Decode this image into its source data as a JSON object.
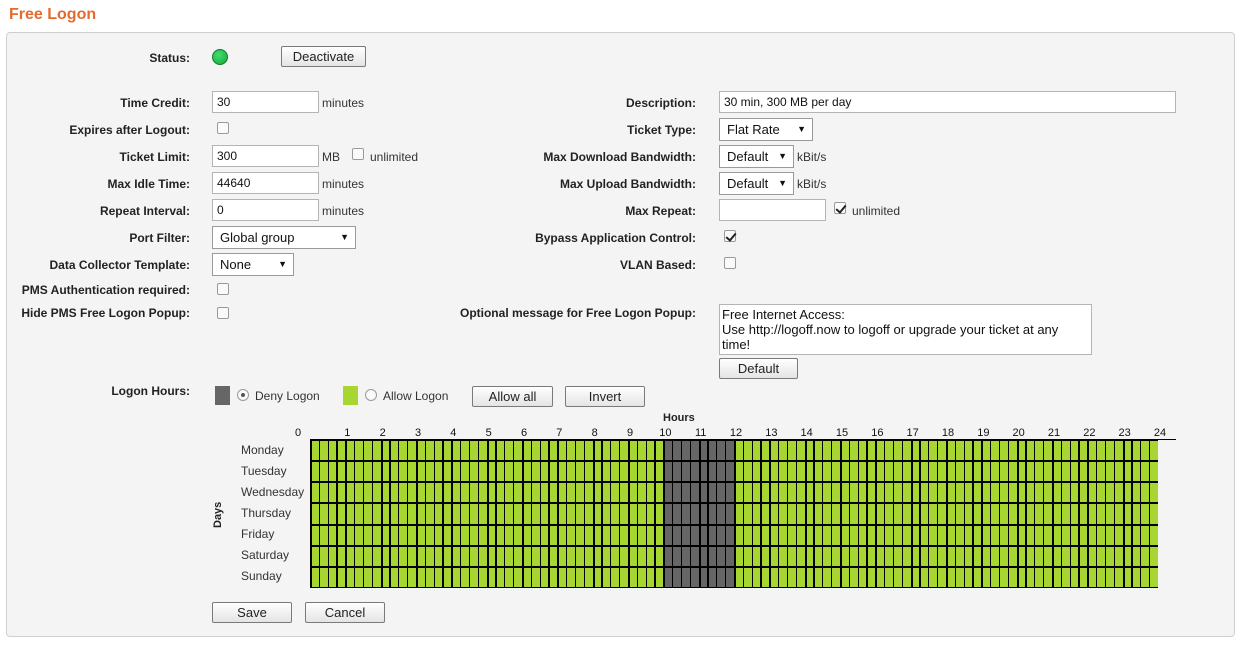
{
  "page": {
    "title": "Free Logon"
  },
  "status": {
    "label": "Status:",
    "button": "Deactivate",
    "color": "#22c55e"
  },
  "left": {
    "time_credit": {
      "label": "Time Credit:",
      "value": "30",
      "unit": "minutes"
    },
    "expires_after_logout": {
      "label": "Expires after Logout:",
      "checked": false
    },
    "ticket_limit": {
      "label": "Ticket Limit:",
      "value": "300",
      "unit": "MB",
      "unlimited_label": "unlimited",
      "unlimited": false
    },
    "max_idle_time": {
      "label": "Max Idle Time:",
      "value": "44640",
      "unit": "minutes"
    },
    "repeat_interval": {
      "label": "Repeat Interval:",
      "value": "0",
      "unit": "minutes"
    },
    "port_filter": {
      "label": "Port Filter:",
      "value": "Global group"
    },
    "data_collector_template": {
      "label": "Data Collector Template:",
      "value": "None"
    },
    "pms_auth": {
      "label": "PMS Authentication required:",
      "checked": false
    },
    "hide_pms_popup": {
      "label": "Hide PMS Free Logon Popup:",
      "checked": false
    }
  },
  "right": {
    "description": {
      "label": "Description:",
      "value": "30 min, 300 MB per day"
    },
    "ticket_type": {
      "label": "Ticket Type:",
      "value": "Flat Rate"
    },
    "max_download": {
      "label": "Max Download Bandwidth:",
      "value": "Default",
      "unit": "kBit/s"
    },
    "max_upload": {
      "label": "Max Upload Bandwidth:",
      "value": "Default",
      "unit": "kBit/s"
    },
    "max_repeat": {
      "label": "Max Repeat:",
      "value": "",
      "unlimited_label": "unlimited",
      "unlimited": true
    },
    "bypass_app_control": {
      "label": "Bypass Application Control:",
      "checked": true
    },
    "vlan_based": {
      "label": "VLAN Based:",
      "checked": false
    },
    "popup_message": {
      "label": "Optional message for Free Logon Popup:",
      "value": "Free Internet Access:\nUse http://logoff.now to logoff or upgrade your ticket at any time!",
      "default_button": "Default"
    }
  },
  "logon_hours": {
    "label": "Logon Hours:",
    "deny_label": "Deny Logon",
    "allow_label": "Allow Logon",
    "deny_color": "#666666",
    "allow_color": "#a8d630",
    "selected_mode": "deny",
    "allow_all_button": "Allow all",
    "invert_button": "Invert",
    "hours_title": "Hours",
    "days_title": "Days",
    "hours": [
      "0",
      "1",
      "2",
      "3",
      "4",
      "5",
      "6",
      "7",
      "8",
      "9",
      "10",
      "11",
      "12",
      "13",
      "14",
      "15",
      "16",
      "17",
      "18",
      "19",
      "20",
      "21",
      "22",
      "23",
      "24"
    ],
    "days": [
      "Monday",
      "Tuesday",
      "Wednesday",
      "Thursday",
      "Friday",
      "Saturday",
      "Sunday"
    ],
    "slots_per_hour": 4,
    "denied_hour_range": [
      10,
      12
    ]
  },
  "footer": {
    "save": "Save",
    "cancel": "Cancel"
  }
}
